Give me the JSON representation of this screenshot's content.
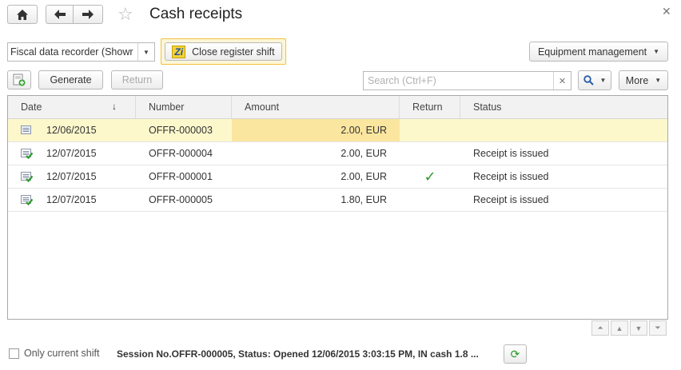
{
  "window": {
    "title": "Cash receipts"
  },
  "toolbar": {
    "fiscal_device": "Fiscal data recorder (Showr",
    "close_shift_label": "Close register shift",
    "equipment_label": "Equipment management",
    "generate_label": "Generate",
    "return_label": "Return",
    "search_placeholder": "Search (Ctrl+F)",
    "more_label": "More"
  },
  "table": {
    "columns": [
      "Date",
      "Number",
      "Amount",
      "Return",
      "Status"
    ],
    "rows": [
      {
        "date": "12/06/2015",
        "number": "OFFR-000003",
        "amount": "2.00, EUR",
        "returned": false,
        "status": "",
        "icon": "document-icon",
        "selected": true
      },
      {
        "date": "12/07/2015",
        "number": "OFFR-000004",
        "amount": "2.00, EUR",
        "returned": false,
        "status": "Receipt is issued",
        "icon": "document-posted-icon",
        "selected": false
      },
      {
        "date": "12/07/2015",
        "number": "OFFR-000001",
        "amount": "2.00, EUR",
        "returned": true,
        "status": "Receipt is issued",
        "icon": "document-posted-icon",
        "selected": false
      },
      {
        "date": "12/07/2015",
        "number": "OFFR-000005",
        "amount": "1.80, EUR",
        "returned": false,
        "status": "Receipt is issued",
        "icon": "document-posted-icon",
        "selected": false
      }
    ]
  },
  "footer": {
    "only_current_shift_label": "Only current shift",
    "only_current_shift_checked": false,
    "session_text": "Session No.OFFR-000005, Status: Opened 12/06/2015 3:03:15 PM, IN cash 1.8 ..."
  },
  "colors": {
    "selected_row": "#fdf8cc",
    "selected_cell": "#fbe6a0",
    "highlight_border": "#f0c340",
    "check": "#2e9a2e"
  }
}
